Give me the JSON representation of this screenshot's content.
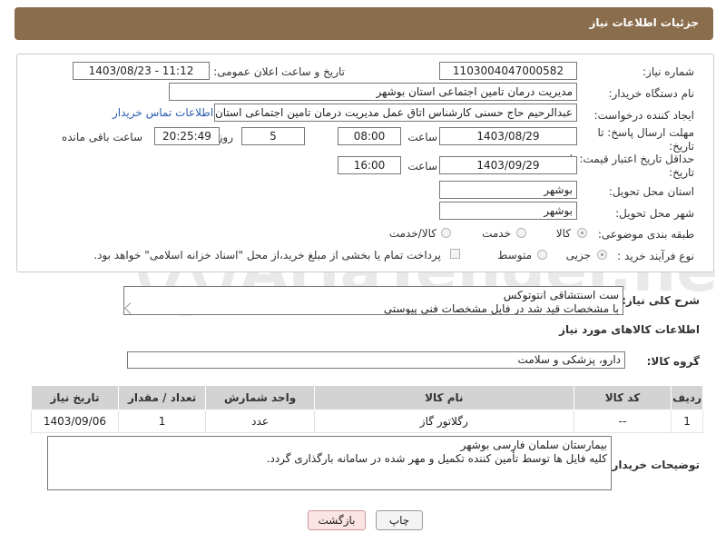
{
  "header": {
    "title": "جزئیات اطلاعات نیاز"
  },
  "form": {
    "need_number": {
      "label": "شماره نیاز:",
      "value": "1103004047000582"
    },
    "announce": {
      "label": "تاریخ و ساعت اعلان عمومی:",
      "value": "1403/08/23 - 11:12"
    },
    "buyer_org": {
      "label": "نام دستگاه خریدار:",
      "value": "مدیریت درمان تامین اجتماعی استان بوشهر"
    },
    "creator": {
      "label": "ایجاد کننده درخواست:",
      "value": "عبدالرحیم حاج حسنی کارشناس اتاق عمل مدیریت درمان تامین اجتماعی استان",
      "link": "اطلاعات تماس خریدار"
    },
    "reply_deadline": {
      "label_line1": "مهلت ارسال پاسخ: تا",
      "label_line2": "تاریخ:",
      "date": "1403/08/29",
      "time_label": "ساعت",
      "time": "08:00",
      "days": "5",
      "days_label": "روز و",
      "remaining": "20:25:49",
      "remaining_label": "ساعت باقی مانده"
    },
    "price_validity": {
      "label_line1": "حداقل تاریخ اعتبار قیمت: تا",
      "label_line2": "تاریخ:",
      "date": "1403/09/29",
      "time_label": "ساعت",
      "time": "16:00"
    },
    "delivery_province": {
      "label": "استان محل تحویل:",
      "value": "بوشهر"
    },
    "delivery_city": {
      "label": "شهر محل تحویل:",
      "value": "بوشهر"
    },
    "category": {
      "label": "طبقه بندی موضوعی:",
      "options": [
        "کالا",
        "خدمت",
        "کالا/خدمت"
      ],
      "selected": "کالا"
    },
    "purchase_type": {
      "label": "نوع فرآیند خرید :",
      "options": [
        "جزیی",
        "متوسط"
      ],
      "selected": "جزیی",
      "note": "پرداخت تمام یا بخشی از مبلغ خرید،از محل \"اسناد خزانه اسلامی\" خواهد بود."
    }
  },
  "description": {
    "label": "شرح کلی نیاز:",
    "line1": "ست اسنتشاقی انتوتوکس",
    "line2": "با مشخصات قید شد در فایل مشخصات فنی پیوستی"
  },
  "goods_section": {
    "title": "اطلاعات کالاهای مورد نیاز",
    "group_label": "گروه کالا:",
    "group_value": "دارو، پزشکی و سلامت"
  },
  "table": {
    "headers": [
      "ردیف",
      "کد کالا",
      "نام کالا",
      "واحد شمارش",
      "تعداد / مقدار",
      "تاریخ نیاز"
    ],
    "rows": [
      [
        "1",
        "--",
        "رگلاتور گاز",
        "عدد",
        "1",
        "1403/09/06"
      ]
    ]
  },
  "buyer_notes": {
    "label": "توضیحات خریدار:",
    "line1": "بیمارستان سلمان فارسی بوشهر",
    "line2": "کلیه فایل ها توسط تأمین کننده تکمیل و مهر شده در سامانه بارگذاری گردد."
  },
  "buttons": {
    "print": "چاپ",
    "back": "بازگشت"
  },
  "watermark": {
    "text": "AriaTender.neT"
  }
}
